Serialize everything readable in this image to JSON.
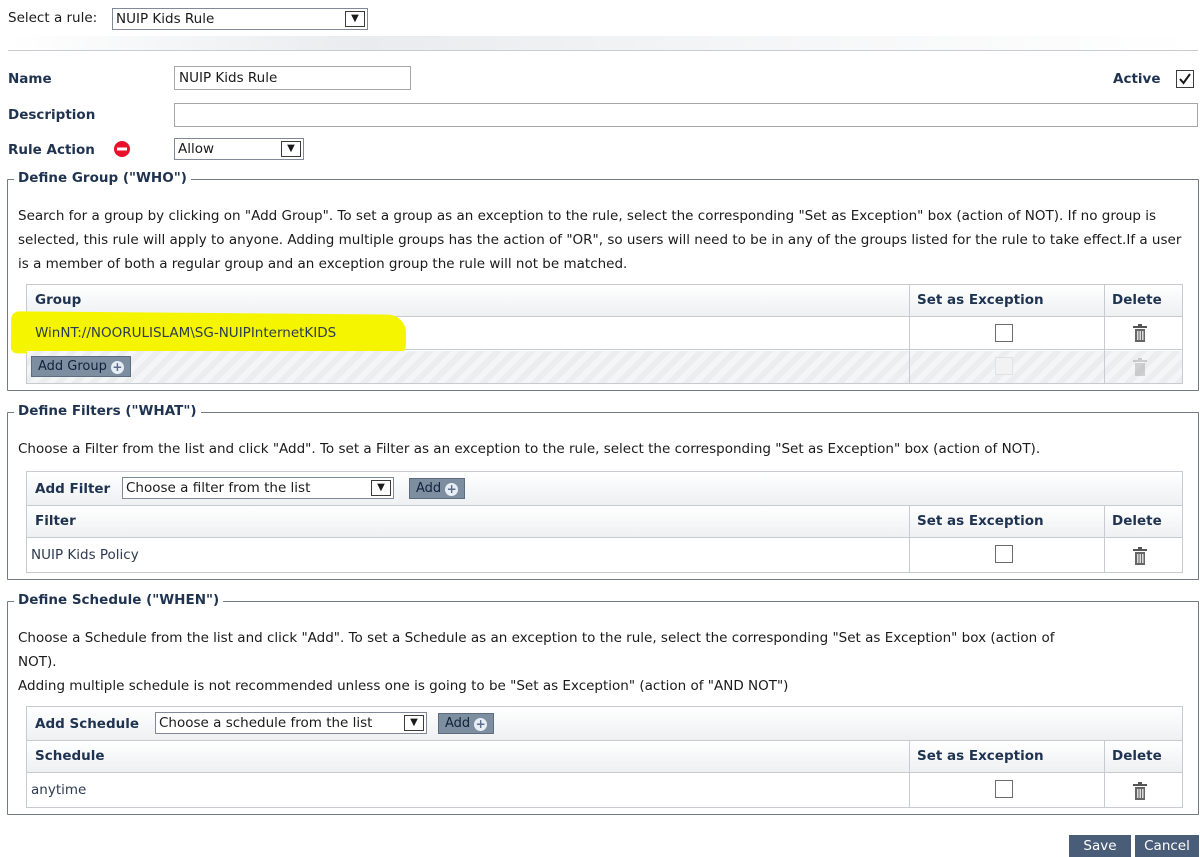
{
  "rule_selector": {
    "label": "Select a rule:",
    "value": "NUIP Kids Rule"
  },
  "name": {
    "label": "Name",
    "value": "NUIP Kids Rule"
  },
  "active": {
    "label": "Active",
    "checked": true
  },
  "description": {
    "label": "Description",
    "value": ""
  },
  "rule_action": {
    "label": "Rule Action",
    "value": "Allow",
    "icon": "no-entry-icon",
    "icon_color": "#e8102a"
  },
  "group_section": {
    "legend": "Define Group (\"WHO\")",
    "description": "Search for a group by clicking on \"Add Group\". To set a group as an exception to the rule, select the corresponding \"Set as Exception\" box (action of NOT). If no group is selected, this rule will apply to anyone. Adding multiple groups has the action of \"OR\", so users will need to be in any of the groups listed for the rule to take effect.If a user is a member of both a regular group and an exception group the rule will not be matched.",
    "columns": [
      "Group",
      "Set as Exception",
      "Delete"
    ],
    "rows": [
      {
        "name": "WinNT://NOORULISLAM\\SG-NUIPInternetKIDS",
        "exception": false,
        "highlight_color": "#f5f500"
      }
    ],
    "add_button": "Add Group"
  },
  "filter_section": {
    "legend": "Define Filters (\"WHAT\")",
    "description": "Choose a Filter from the list and click \"Add\". To set a Filter as an exception to the rule, select the corresponding \"Set as Exception\" box (action of NOT).",
    "add_label": "Add Filter",
    "select_placeholder": "Choose a filter from the list",
    "add_button": "Add",
    "columns": [
      "Filter",
      "Set as Exception",
      "Delete"
    ],
    "rows": [
      {
        "name": "NUIP Kids Policy",
        "exception": false
      }
    ]
  },
  "schedule_section": {
    "legend": "Define Schedule (\"WHEN\")",
    "description_1": "Choose a Schedule from the list and click \"Add\". To set a Schedule as an exception to the rule, select the corresponding \"Set as Exception\" box (action of",
    "description_2": "NOT).",
    "description_3": "Adding multiple schedule is not recommended unless one is going to be \"Set as Exception\" (action of \"AND NOT\")",
    "add_label": "Add Schedule",
    "select_placeholder": "Choose a schedule from the list",
    "add_button": "Add",
    "columns": [
      "Schedule",
      "Set as Exception",
      "Delete"
    ],
    "rows": [
      {
        "name": "anytime",
        "exception": false
      }
    ]
  },
  "footer": {
    "save": "Save",
    "cancel": "Cancel"
  }
}
